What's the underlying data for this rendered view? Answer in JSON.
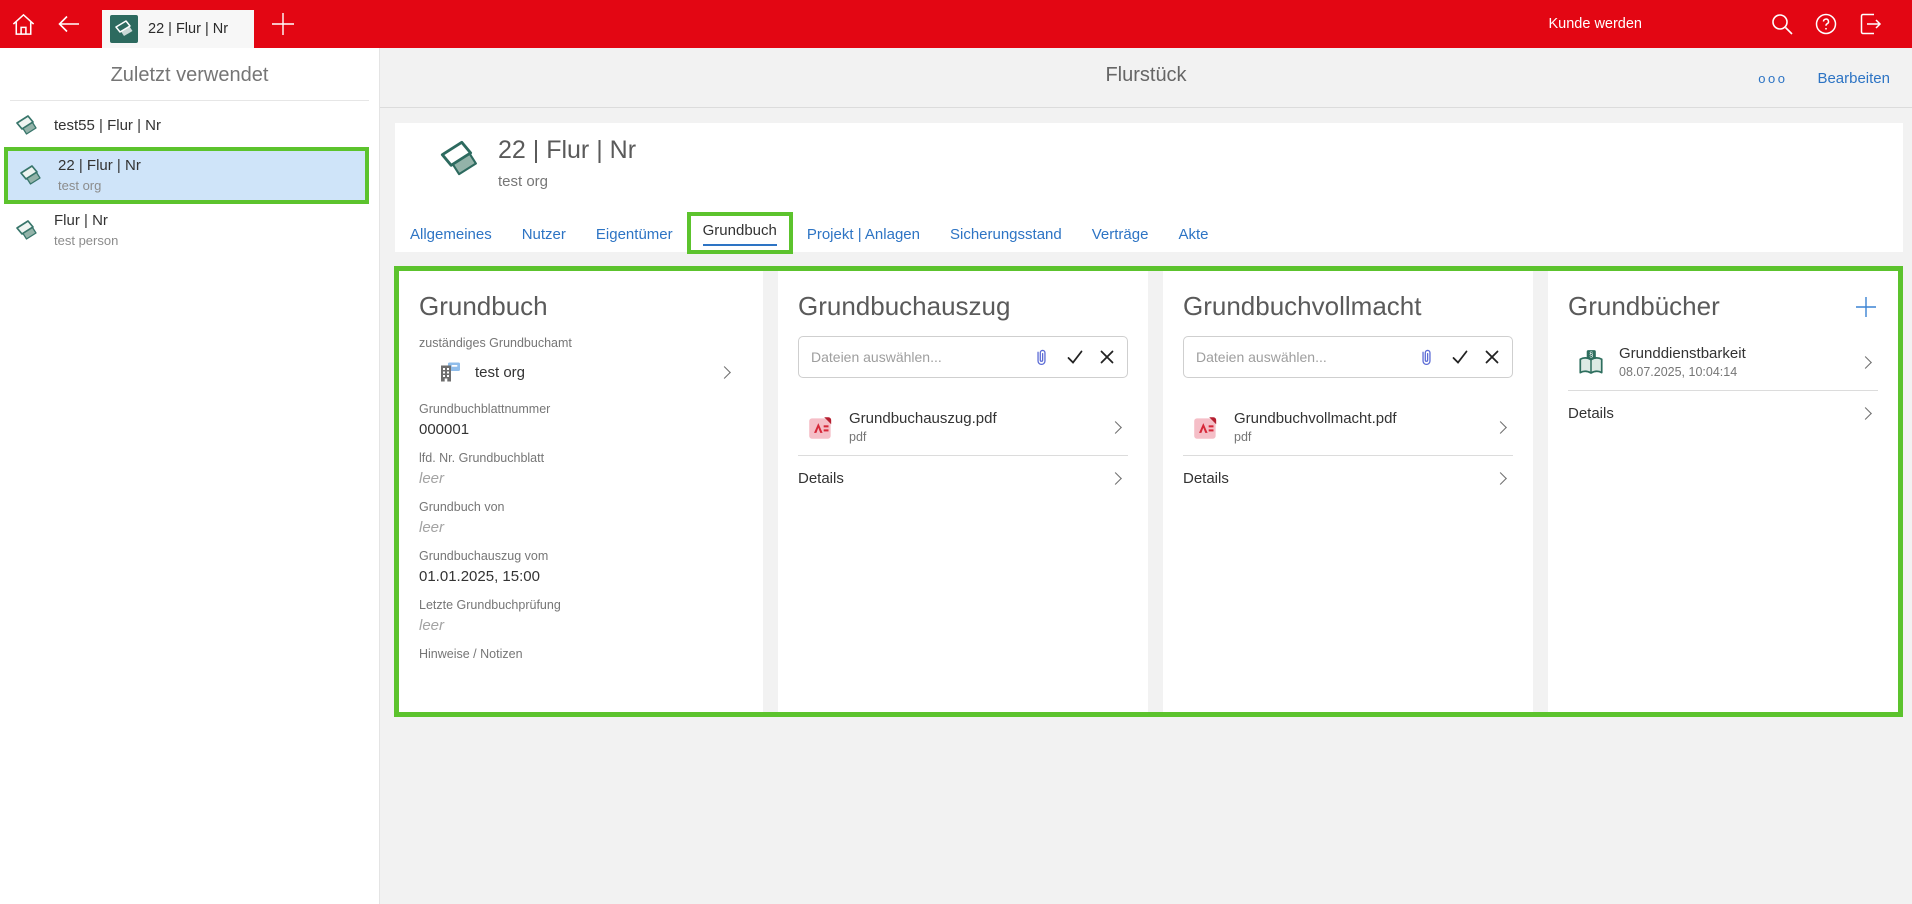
{
  "topbar": {
    "tab_label": "22 | Flur | Nr",
    "kunde_werden_label": "Kunde werden"
  },
  "sidebar": {
    "title": "Zuletzt verwendet",
    "items": [
      {
        "label": "test55 | Flur | Nr",
        "sublabel": ""
      },
      {
        "label": "22 | Flur | Nr",
        "sublabel": "test org",
        "selected": true
      },
      {
        "label": "Flur | Nr",
        "sublabel": "test person"
      }
    ]
  },
  "main_header": {
    "title": "Flurstück",
    "more_icon": "ooo",
    "edit_label": "Bearbeiten"
  },
  "record": {
    "title": "22 | Flur | Nr",
    "subtitle": "test org"
  },
  "tabs": [
    "Allgemeines",
    "Nutzer",
    "Eigentümer",
    "Grundbuch",
    "Projekt | Anlagen",
    "Sicherungsstand",
    "Verträge",
    "Akte"
  ],
  "active_tab": "Grundbuch",
  "panels": {
    "grundbuch": {
      "title": "Grundbuch",
      "fields": [
        {
          "label": "zuständiges Grundbuchamt",
          "value": "test org"
        },
        {
          "label": "Grundbuchblattnummer",
          "value": "000001"
        },
        {
          "label": "lfd. Nr. Grundbuchblatt",
          "value": "leer",
          "empty": true
        },
        {
          "label": "Grundbuch von",
          "value": "leer",
          "empty": true
        },
        {
          "label": "Grundbuchauszug vom",
          "value": "01.01.2025, 15:00"
        },
        {
          "label": "Letzte Grundbuchprüfung",
          "value": "leer",
          "empty": true
        },
        {
          "label": "Hinweise / Notizen",
          "value": ""
        }
      ]
    },
    "grundbuchauszug": {
      "title": "Grundbuchauszug",
      "file_placeholder": "Dateien auswählen...",
      "file": {
        "name": "Grundbuchauszug.pdf",
        "type": "pdf"
      },
      "details_label": "Details"
    },
    "grundbuchvollmacht": {
      "title": "Grundbuchvollmacht",
      "file_placeholder": "Dateien auswählen...",
      "file": {
        "name": "Grundbuchvollmacht.pdf",
        "type": "pdf"
      },
      "details_label": "Details"
    },
    "grundbuecher": {
      "title": "Grundbücher",
      "item": {
        "label": "Grunddienstbarkeit",
        "timestamp": "08.07.2025, 10:04:14"
      },
      "details_label": "Details"
    }
  },
  "colors": {
    "topbar_red": "#e30613",
    "annotation_green": "#5cc32d",
    "link_blue": "#2d74c4",
    "selected_item_bg": "#cfe4f9",
    "tab_icon_teal": "#2d6a5f"
  },
  "icons": [
    "home-icon",
    "back-icon",
    "flurstueck-tab-icon",
    "plus-icon",
    "search-icon",
    "help-icon",
    "logout-icon",
    "parcel-icon",
    "organisation-icon",
    "pdf-file-icon",
    "paperclip-icon",
    "check-icon",
    "clear-icon",
    "chevron-right-icon",
    "add-icon",
    "more-options-icon",
    "grundbuch-book-icon"
  ]
}
